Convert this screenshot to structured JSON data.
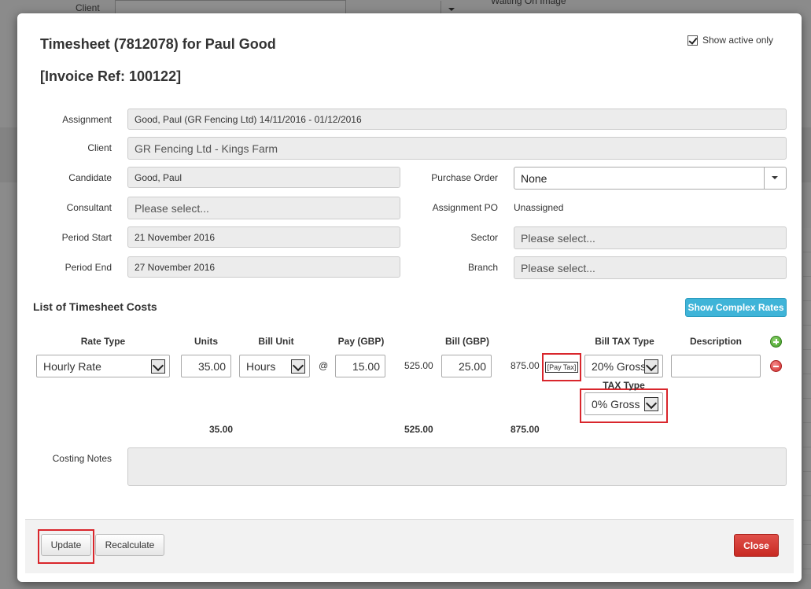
{
  "background": {
    "client_label": "Client",
    "waiting_label": "Waiting On Image"
  },
  "modal": {
    "title": "Timesheet (7812078) for Paul Good",
    "subtitle": "[Invoice Ref: 100122]",
    "show_active_label": "Show active only",
    "show_active_checked": true
  },
  "form": {
    "assignment_label": "Assignment",
    "assignment_value": "Good, Paul (GR Fencing Ltd) 14/11/2016 - 01/12/2016",
    "client_label": "Client",
    "client_value": "GR Fencing Ltd - Kings Farm",
    "candidate_label": "Candidate",
    "candidate_value": "Good, Paul",
    "consultant_label": "Consultant",
    "consultant_placeholder": "Please select...",
    "period_start_label": "Period Start",
    "period_start_value": "21 November 2016",
    "period_end_label": "Period End",
    "period_end_value": "27 November 2016",
    "purchase_order_label": "Purchase Order",
    "purchase_order_value": "None",
    "assignment_po_label": "Assignment PO",
    "assignment_po_value": "Unassigned",
    "sector_label": "Sector",
    "sector_placeholder": "Please select...",
    "branch_label": "Branch",
    "branch_placeholder": "Please select..."
  },
  "costs": {
    "section_title": "List of Timesheet Costs",
    "complex_rates_button": "Show Complex Rates",
    "headers": {
      "rate_type": "Rate Type",
      "units": "Units",
      "bill_unit": "Bill Unit",
      "pay": "Pay (GBP)",
      "bill": "Bill (GBP)",
      "bill_tax_type": "Bill TAX Type",
      "description": "Description",
      "tax_type": "TAX Type"
    },
    "row": {
      "rate_type": "Hourly Rate",
      "units": "35.00",
      "bill_unit": "Hours",
      "at": "@",
      "pay": "15.00",
      "pay_total": "525.00",
      "bill": "25.00",
      "bill_total": "875.00",
      "pay_tax_tag": "[Pay Tax]",
      "bill_tax_type": "20% Gross",
      "tax_type": "0% Gross",
      "description": ""
    },
    "totals": {
      "units": "35.00",
      "pay": "525.00",
      "bill": "875.00"
    },
    "costing_notes_label": "Costing Notes"
  },
  "footer": {
    "update_label": "Update",
    "recalculate_label": "Recalculate",
    "close_label": "Close"
  },
  "colors": {
    "accent_blue": "#3fb4d8",
    "close_red": "#c82a23",
    "highlight_red": "#d9262c"
  }
}
